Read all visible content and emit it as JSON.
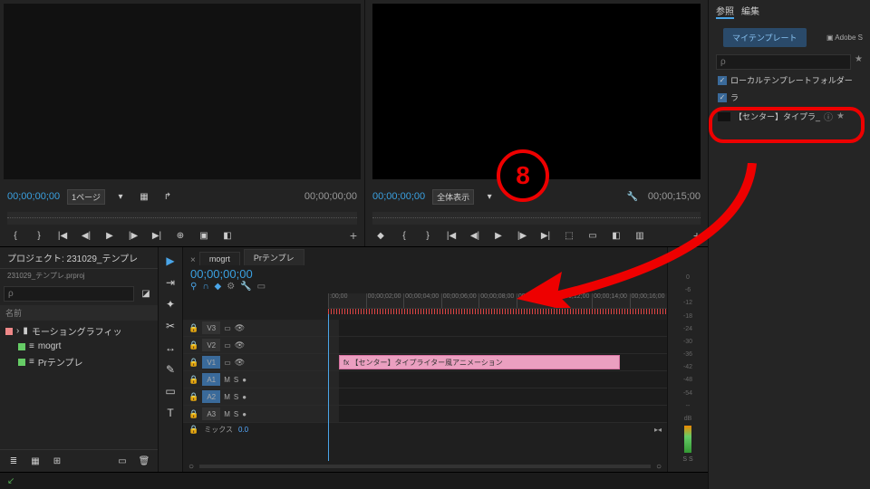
{
  "source": {
    "tc_in": "00;00;00;00",
    "page_sel": "1ページ",
    "tc_out": "00;00;00;00"
  },
  "program": {
    "tc_in": "00;00;00;00",
    "fit_sel": "全体表示",
    "tc_out": "00;00;15;00"
  },
  "project": {
    "tab": "プロジェクト: 231029_テンプレ",
    "file": "231029_テンプレ.prproj",
    "search_ph": "ρ",
    "col_name": "名前",
    "items": [
      {
        "color": "#e88",
        "label": "モーショングラフィッ",
        "icon": "folder"
      },
      {
        "color": "#6c6",
        "label": "mogrt",
        "icon": "seq"
      },
      {
        "color": "#6c6",
        "label": "Prテンプレ",
        "icon": "seq"
      }
    ]
  },
  "timeline": {
    "tabs": [
      "mogrt",
      "Prテンプレ"
    ],
    "tc": "00;00;00;00",
    "ticks": [
      ":00;00",
      "00;00;02;00",
      "00;00;04;00",
      "00;00;06;00",
      "00;00;08;00",
      "00;00;10;00",
      "00;00;12;00",
      "00;00;14;00",
      "00;00;16;00"
    ],
    "v3": "V3",
    "v2": "V2",
    "v1": "V1",
    "a1": "A1",
    "a2": "A2",
    "a3": "A3",
    "clip_label": "fx 【センター】タイプライター風アニメーション",
    "mix": "ミックス",
    "mix_val": "0.0"
  },
  "audio_scale": [
    "0",
    "-6",
    "-12",
    "-18",
    "-24",
    "-30",
    "-36",
    "-42",
    "-48",
    "-54",
    "--",
    "dB"
  ],
  "right": {
    "tab_ref": "参照",
    "tab_edit": "編集",
    "mytpl": "マイテンプレート",
    "adobe": "Adobe S",
    "search_ph": "ρ",
    "chk_local": "ローカルテンプレートフォルダー",
    "chk_lib": "ラ",
    "item_label": "【センター】タイプラ_"
  },
  "annotation": {
    "num": "8"
  }
}
